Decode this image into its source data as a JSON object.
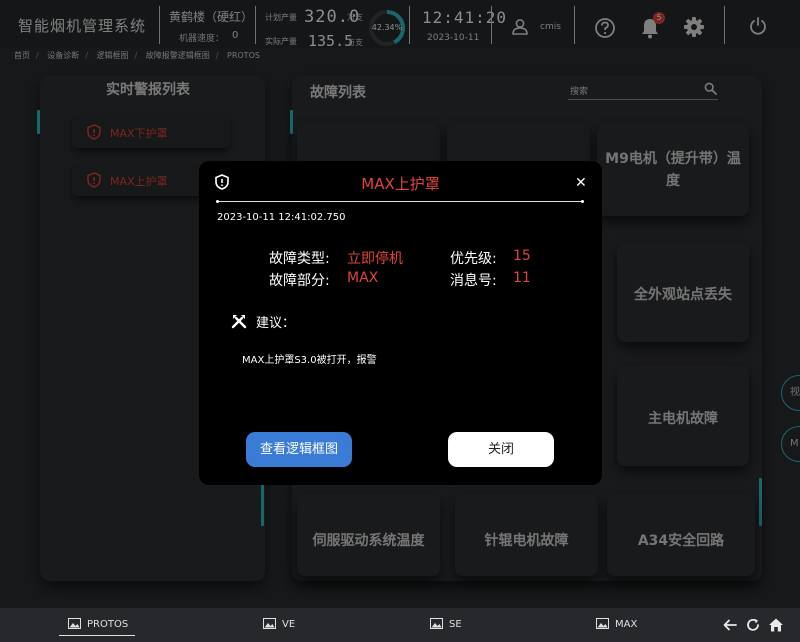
{
  "header": {
    "app_title": "智能烟机管理系统",
    "brand": "黄鹤楼（硬红）",
    "machine_speed_label": "机器速度：",
    "machine_speed_value": "0",
    "plan_output_label": "计划产量",
    "plan_output_value": "320.0",
    "plan_output_unit": "万支",
    "actual_output_label": "实际产量",
    "actual_output_value": "135.5",
    "actual_output_unit": "万支",
    "completion_percent_label": "42.34%",
    "completion_fraction": 0.4234,
    "time": "12:41:20",
    "date": "2023-10-11",
    "username": "cmis",
    "notification_count": "5"
  },
  "breadcrumb": [
    "首页",
    "设备诊断",
    "逻辑框图",
    "故障报警逻辑框图",
    "PROTOS"
  ],
  "left_panel": {
    "title": "实时警报列表",
    "alarms": [
      "MAX下护罩",
      "MAX上护罩"
    ]
  },
  "right_panel": {
    "title": "故障列表",
    "search_placeholder": "搜索",
    "cards": [
      "M9电机（提升带）温度",
      "全外观站点丢失",
      "主电机故障",
      "伺服驱动系统温度",
      "针辊电机故障",
      "A34安全回路"
    ]
  },
  "side_buttons": [
    "视",
    "M"
  ],
  "modal": {
    "title": "MAX上护罩",
    "timestamp": "2023-10-11 12:41:02.750",
    "fault_type_label": "故障类型:",
    "fault_type_value": "立即停机",
    "priority_label": "优先级:",
    "priority_value": "15",
    "fault_part_label": "故障部分:",
    "fault_part_value": "MAX",
    "message_no_label": "消息号:",
    "message_no_value": "11",
    "advice_label": "建议：",
    "advice_text": "MAX上护罩S3.0被打开，报警",
    "view_logic_button": "查看逻辑框图",
    "close_button": "关闭"
  },
  "bottom_tabs": [
    "PROTOS",
    "VE",
    "SE",
    "MAX"
  ],
  "colors": {
    "alarm_red": "#e0443c",
    "accent_teal": "#2bbcc6",
    "primary_blue": "#3a7bd5"
  }
}
